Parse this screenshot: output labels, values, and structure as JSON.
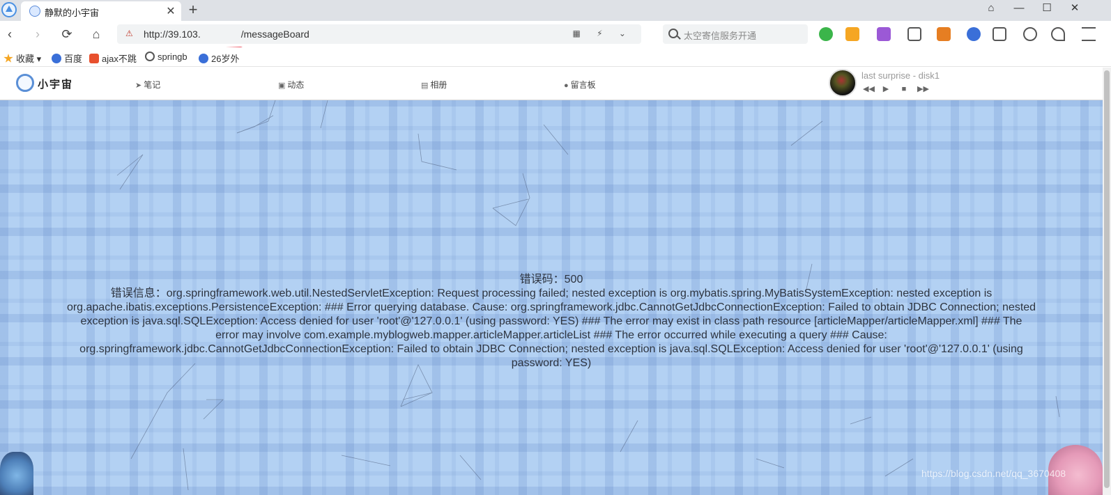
{
  "tab": {
    "title": "静默的小宇宙",
    "close": "✕",
    "new_tab": "+"
  },
  "window_controls": {
    "pin": "⌂",
    "minimize": "—",
    "maximize": "☐",
    "close": "✕"
  },
  "nav": {
    "back": "‹",
    "forward": "›",
    "reload": "⟳",
    "home": "⌂"
  },
  "address_bar": {
    "prefix": "http://39.103.",
    "suffix": "/messageBoard",
    "security_icon": "⚠",
    "tools": "▦ ⚡ ⌄"
  },
  "search": {
    "placeholder": "太空寄信服务开通"
  },
  "bookmarks": [
    {
      "label": "收藏",
      "icon": "star-icon",
      "color": "#f5a623"
    },
    {
      "label": "百度",
      "icon": "paw-icon",
      "color": "#3a6fd8"
    },
    {
      "label": "ajax不跳",
      "icon": "c-icon",
      "color": "#e8502e"
    },
    {
      "label": "springb",
      "icon": "spring-icon",
      "color": "#555555"
    },
    {
      "label": "26岁外",
      "icon": "paw-icon",
      "color": "#3a6fd8"
    }
  ],
  "site": {
    "logo_text": "小宇宙",
    "menu": [
      {
        "label": "笔记",
        "icon": "send-icon",
        "glyph": "➤"
      },
      {
        "label": "动态",
        "icon": "robot-icon",
        "glyph": "▣"
      },
      {
        "label": "相册",
        "icon": "image-icon",
        "glyph": "▤"
      },
      {
        "label": "留言板",
        "icon": "comment-icon",
        "glyph": "●"
      }
    ]
  },
  "player": {
    "song": "last surprise - disk1",
    "controls": {
      "prev": "◀◀",
      "play": "▶",
      "stop": "■",
      "next": "▶▶"
    }
  },
  "error": {
    "code_line": "错误码：500",
    "lines": [
      "错误信息：org.springframework.web.util.NestedServletException: Request processing failed; nested exception is org.mybatis.spring.MyBatisSystemException: nested exception is",
      "org.apache.ibatis.exceptions.PersistenceException: ### Error querying database. Cause: org.springframework.jdbc.CannotGetJdbcConnectionException: Failed to obtain JDBC Connection; nested",
      "exception is java.sql.SQLException: Access denied for user 'root'@'127.0.0.1' (using password: YES) ### The error may exist in class path resource [articleMapper/articleMapper.xml] ### The",
      "error may involve com.example.myblogweb.mapper.articleMapper.articleList ### The error occurred while executing a query ### Cause:",
      "org.springframework.jdbc.CannotGetJdbcConnectionException: Failed to obtain JDBC Connection; nested exception is java.sql.SQLException: Access denied for user 'root'@'127.0.0.1' (using",
      "password: YES)"
    ]
  },
  "watermark": "https://blog.csdn.net/qq_3670408"
}
